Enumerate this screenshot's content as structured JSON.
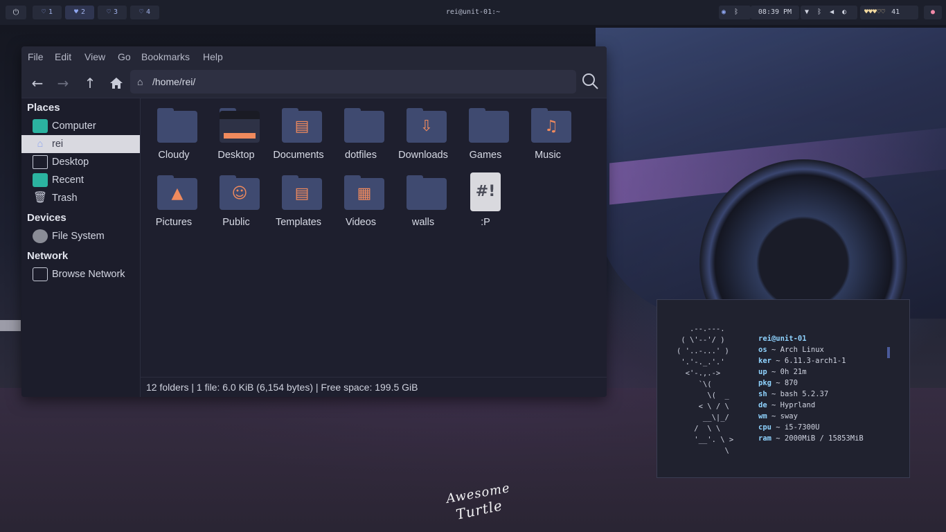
{
  "topbar": {
    "power_icon": "power-icon",
    "workspaces": [
      {
        "num": "1",
        "active": false
      },
      {
        "num": "2",
        "active": true
      },
      {
        "num": "3",
        "active": false
      },
      {
        "num": "4",
        "active": false
      }
    ],
    "window_title": "rei@unit-01:~",
    "clock": "08:39 PM",
    "battery": "41",
    "accent": "#8fa6f0"
  },
  "filemanager": {
    "menu": [
      "File",
      "Edit",
      "View",
      "Go",
      "Bookmarks",
      "Help"
    ],
    "path": "/home/rei/",
    "sidebar": {
      "places_title": "Places",
      "places": [
        {
          "label": "Computer",
          "icon": "computer-icon"
        },
        {
          "label": "rei",
          "icon": "home-icon",
          "selected": true
        },
        {
          "label": "Desktop",
          "icon": "desktop-icon"
        },
        {
          "label": "Recent",
          "icon": "recent-icon"
        },
        {
          "label": "Trash",
          "icon": "trash-icon"
        }
      ],
      "devices_title": "Devices",
      "devices": [
        {
          "label": "File System",
          "icon": "drive-icon"
        }
      ],
      "network_title": "Network",
      "network": [
        {
          "label": "Browse Network",
          "icon": "network-icon"
        }
      ]
    },
    "items": [
      {
        "label": "Cloudy",
        "icon": "folder-icon"
      },
      {
        "label": "Desktop",
        "icon": "desktop-folder-icon"
      },
      {
        "label": "Documents",
        "icon": "documents-folder-icon"
      },
      {
        "label": "dotfiles",
        "icon": "folder-icon"
      },
      {
        "label": "Downloads",
        "icon": "downloads-folder-icon"
      },
      {
        "label": "Games",
        "icon": "folder-icon"
      },
      {
        "label": "Music",
        "icon": "music-folder-icon"
      },
      {
        "label": "Pictures",
        "icon": "pictures-folder-icon"
      },
      {
        "label": "Public",
        "icon": "public-folder-icon"
      },
      {
        "label": "Templates",
        "icon": "templates-folder-icon"
      },
      {
        "label": "Videos",
        "icon": "videos-folder-icon"
      },
      {
        "label": "walls",
        "icon": "folder-icon"
      },
      {
        "label": ":P",
        "icon": "script-file-icon",
        "glyph": "#!"
      }
    ],
    "status": "12 folders  |  1 file: 6.0 KiB (6,154 bytes)  |  Free space: 199.5 GiB"
  },
  "terminal": {
    "ascii_art": "   .--.---.\n ( \\'--'/ )\n( '..-...' )\n '.'-._.'.'\n  <'-.,.->\n     `\\(\n       \\(  _\n     < \\ / \\\n      __\\|_/\n    /  \\ \\\n    '__'. \\ >\n           \\",
    "host": "rei@unit-01",
    "info": [
      {
        "key": "os",
        "value": " ~ Arch Linux"
      },
      {
        "key": "ker",
        "value": " ~ 6.11.3-arch1-1"
      },
      {
        "key": "up",
        "value": " ~ 0h 21m"
      },
      {
        "key": "pkg",
        "value": " ~ 870"
      },
      {
        "key": "sh",
        "value": " ~ bash 5.2.37"
      },
      {
        "key": "de",
        "value": " ~ Hyprland"
      },
      {
        "key": "wm",
        "value": " ~ sway"
      },
      {
        "key": "cpu",
        "value": " ~ i5-7300U"
      },
      {
        "key": "ram",
        "value": " ~ 2000MiB / 15853MiB"
      }
    ]
  },
  "wallpaper_logo": {
    "line1": "Awesome",
    "line2": "Turtle"
  }
}
